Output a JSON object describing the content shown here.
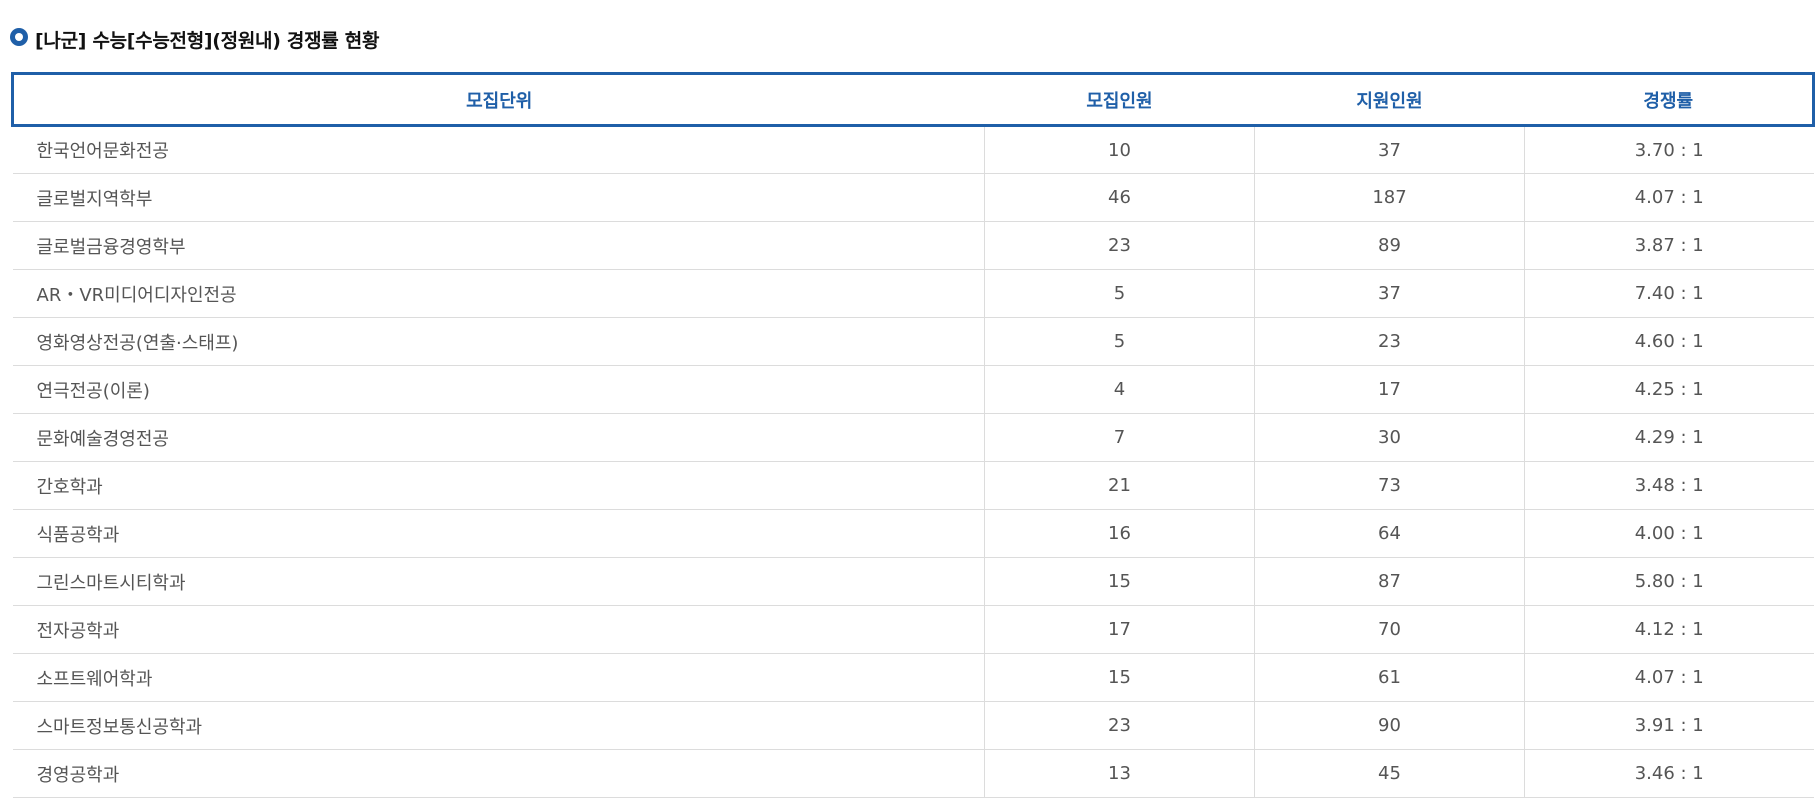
{
  "header": {
    "title": "[나군] 수능[수능전형](정원내) 경쟁률 현황"
  },
  "table": {
    "columns": [
      "모집단위",
      "모집인원",
      "지원인원",
      "경쟁률"
    ],
    "rows": [
      {
        "unit": "한국언어문화전공",
        "quota": "10",
        "applicants": "37",
        "ratio": "3.70 : 1"
      },
      {
        "unit": "글로벌지역학부",
        "quota": "46",
        "applicants": "187",
        "ratio": "4.07 : 1"
      },
      {
        "unit": "글로벌금융경영학부",
        "quota": "23",
        "applicants": "89",
        "ratio": "3.87 : 1"
      },
      {
        "unit": "AR・VR미디어디자인전공",
        "quota": "5",
        "applicants": "37",
        "ratio": "7.40 : 1"
      },
      {
        "unit": "영화영상전공(연출·스태프)",
        "quota": "5",
        "applicants": "23",
        "ratio": "4.60 : 1"
      },
      {
        "unit": "연극전공(이론)",
        "quota": "4",
        "applicants": "17",
        "ratio": "4.25 : 1"
      },
      {
        "unit": "문화예술경영전공",
        "quota": "7",
        "applicants": "30",
        "ratio": "4.29 : 1"
      },
      {
        "unit": "간호학과",
        "quota": "21",
        "applicants": "73",
        "ratio": "3.48 : 1"
      },
      {
        "unit": "식품공학과",
        "quota": "16",
        "applicants": "64",
        "ratio": "4.00 : 1"
      },
      {
        "unit": "그린스마트시티학과",
        "quota": "15",
        "applicants": "87",
        "ratio": "5.80 : 1"
      },
      {
        "unit": "전자공학과",
        "quota": "17",
        "applicants": "70",
        "ratio": "4.12 : 1"
      },
      {
        "unit": "소프트웨어학과",
        "quota": "15",
        "applicants": "61",
        "ratio": "4.07 : 1"
      },
      {
        "unit": "스마트정보통신공학과",
        "quota": "23",
        "applicants": "90",
        "ratio": "3.91 : 1"
      },
      {
        "unit": "경영공학과",
        "quota": "13",
        "applicants": "45",
        "ratio": "3.46 : 1"
      }
    ]
  },
  "colors": {
    "accent": "#1f5fa8",
    "text": "#555555",
    "border": "#dcdcdc"
  },
  "icons": {
    "bullet": "circle-bullet-icon"
  }
}
